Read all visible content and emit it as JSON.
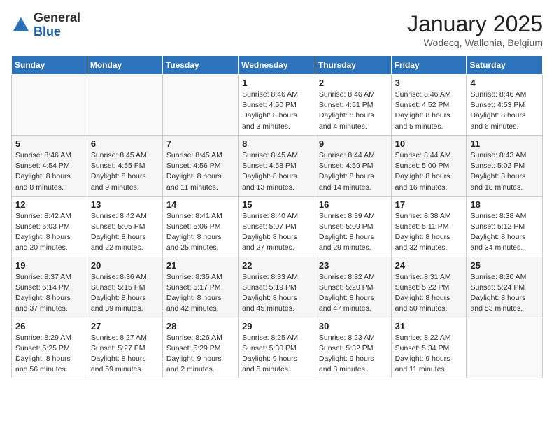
{
  "header": {
    "logo_general": "General",
    "logo_blue": "Blue",
    "title": "January 2025",
    "location": "Wodecq, Wallonia, Belgium"
  },
  "days_of_week": [
    "Sunday",
    "Monday",
    "Tuesday",
    "Wednesday",
    "Thursday",
    "Friday",
    "Saturday"
  ],
  "weeks": [
    [
      {
        "day": "",
        "info": ""
      },
      {
        "day": "",
        "info": ""
      },
      {
        "day": "",
        "info": ""
      },
      {
        "day": "1",
        "info": "Sunrise: 8:46 AM\nSunset: 4:50 PM\nDaylight: 8 hours\nand 3 minutes."
      },
      {
        "day": "2",
        "info": "Sunrise: 8:46 AM\nSunset: 4:51 PM\nDaylight: 8 hours\nand 4 minutes."
      },
      {
        "day": "3",
        "info": "Sunrise: 8:46 AM\nSunset: 4:52 PM\nDaylight: 8 hours\nand 5 minutes."
      },
      {
        "day": "4",
        "info": "Sunrise: 8:46 AM\nSunset: 4:53 PM\nDaylight: 8 hours\nand 6 minutes."
      }
    ],
    [
      {
        "day": "5",
        "info": "Sunrise: 8:46 AM\nSunset: 4:54 PM\nDaylight: 8 hours\nand 8 minutes."
      },
      {
        "day": "6",
        "info": "Sunrise: 8:45 AM\nSunset: 4:55 PM\nDaylight: 8 hours\nand 9 minutes."
      },
      {
        "day": "7",
        "info": "Sunrise: 8:45 AM\nSunset: 4:56 PM\nDaylight: 8 hours\nand 11 minutes."
      },
      {
        "day": "8",
        "info": "Sunrise: 8:45 AM\nSunset: 4:58 PM\nDaylight: 8 hours\nand 13 minutes."
      },
      {
        "day": "9",
        "info": "Sunrise: 8:44 AM\nSunset: 4:59 PM\nDaylight: 8 hours\nand 14 minutes."
      },
      {
        "day": "10",
        "info": "Sunrise: 8:44 AM\nSunset: 5:00 PM\nDaylight: 8 hours\nand 16 minutes."
      },
      {
        "day": "11",
        "info": "Sunrise: 8:43 AM\nSunset: 5:02 PM\nDaylight: 8 hours\nand 18 minutes."
      }
    ],
    [
      {
        "day": "12",
        "info": "Sunrise: 8:42 AM\nSunset: 5:03 PM\nDaylight: 8 hours\nand 20 minutes."
      },
      {
        "day": "13",
        "info": "Sunrise: 8:42 AM\nSunset: 5:05 PM\nDaylight: 8 hours\nand 22 minutes."
      },
      {
        "day": "14",
        "info": "Sunrise: 8:41 AM\nSunset: 5:06 PM\nDaylight: 8 hours\nand 25 minutes."
      },
      {
        "day": "15",
        "info": "Sunrise: 8:40 AM\nSunset: 5:07 PM\nDaylight: 8 hours\nand 27 minutes."
      },
      {
        "day": "16",
        "info": "Sunrise: 8:39 AM\nSunset: 5:09 PM\nDaylight: 8 hours\nand 29 minutes."
      },
      {
        "day": "17",
        "info": "Sunrise: 8:38 AM\nSunset: 5:11 PM\nDaylight: 8 hours\nand 32 minutes."
      },
      {
        "day": "18",
        "info": "Sunrise: 8:38 AM\nSunset: 5:12 PM\nDaylight: 8 hours\nand 34 minutes."
      }
    ],
    [
      {
        "day": "19",
        "info": "Sunrise: 8:37 AM\nSunset: 5:14 PM\nDaylight: 8 hours\nand 37 minutes."
      },
      {
        "day": "20",
        "info": "Sunrise: 8:36 AM\nSunset: 5:15 PM\nDaylight: 8 hours\nand 39 minutes."
      },
      {
        "day": "21",
        "info": "Sunrise: 8:35 AM\nSunset: 5:17 PM\nDaylight: 8 hours\nand 42 minutes."
      },
      {
        "day": "22",
        "info": "Sunrise: 8:33 AM\nSunset: 5:19 PM\nDaylight: 8 hours\nand 45 minutes."
      },
      {
        "day": "23",
        "info": "Sunrise: 8:32 AM\nSunset: 5:20 PM\nDaylight: 8 hours\nand 47 minutes."
      },
      {
        "day": "24",
        "info": "Sunrise: 8:31 AM\nSunset: 5:22 PM\nDaylight: 8 hours\nand 50 minutes."
      },
      {
        "day": "25",
        "info": "Sunrise: 8:30 AM\nSunset: 5:24 PM\nDaylight: 8 hours\nand 53 minutes."
      }
    ],
    [
      {
        "day": "26",
        "info": "Sunrise: 8:29 AM\nSunset: 5:25 PM\nDaylight: 8 hours\nand 56 minutes."
      },
      {
        "day": "27",
        "info": "Sunrise: 8:27 AM\nSunset: 5:27 PM\nDaylight: 8 hours\nand 59 minutes."
      },
      {
        "day": "28",
        "info": "Sunrise: 8:26 AM\nSunset: 5:29 PM\nDaylight: 9 hours\nand 2 minutes."
      },
      {
        "day": "29",
        "info": "Sunrise: 8:25 AM\nSunset: 5:30 PM\nDaylight: 9 hours\nand 5 minutes."
      },
      {
        "day": "30",
        "info": "Sunrise: 8:23 AM\nSunset: 5:32 PM\nDaylight: 9 hours\nand 8 minutes."
      },
      {
        "day": "31",
        "info": "Sunrise: 8:22 AM\nSunset: 5:34 PM\nDaylight: 9 hours\nand 11 minutes."
      },
      {
        "day": "",
        "info": ""
      }
    ]
  ]
}
